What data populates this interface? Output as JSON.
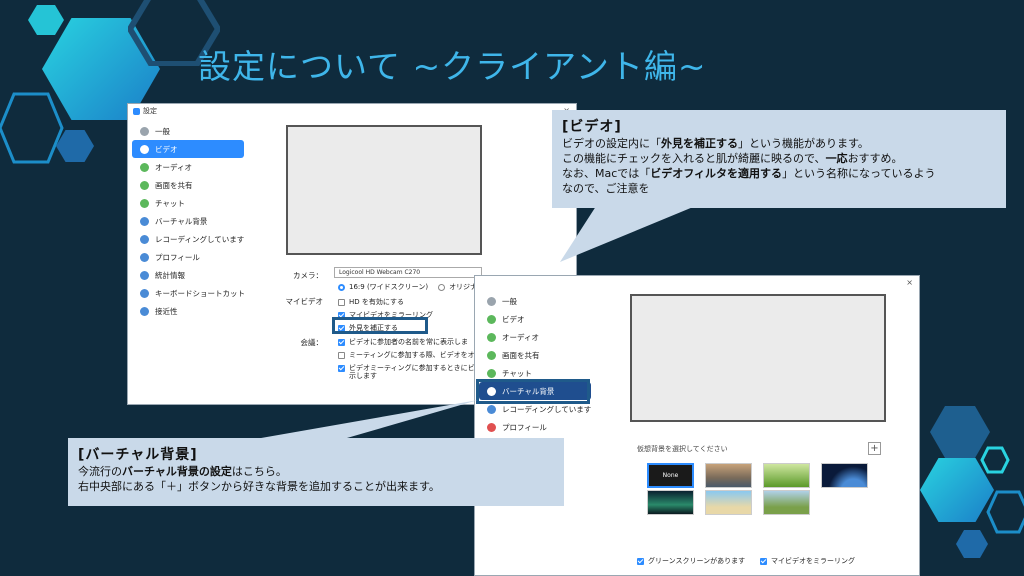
{
  "slide": {
    "title": "設定について ~クライアント編~"
  },
  "window1": {
    "title": "設定",
    "close": "×",
    "sidebar": [
      {
        "label": "一般",
        "icon": "gear-icon"
      },
      {
        "label": "ビデオ",
        "icon": "video-icon",
        "active": true
      },
      {
        "label": "オーディオ",
        "icon": "headphone-icon"
      },
      {
        "label": "画面を共有",
        "icon": "share-screen-icon"
      },
      {
        "label": "チャット",
        "icon": "chat-icon"
      },
      {
        "label": "バーチャル背景",
        "icon": "virtual-background-icon"
      },
      {
        "label": "レコーディングしています",
        "icon": "record-icon"
      },
      {
        "label": "プロフィール",
        "icon": "profile-icon"
      },
      {
        "label": "統計情報",
        "icon": "statistics-icon"
      },
      {
        "label": "キーボードショートカット",
        "icon": "keyboard-icon"
      },
      {
        "label": "接近性",
        "icon": "accessibility-icon"
      }
    ],
    "camera_label": "カメラ：",
    "camera_value": "Logicool HD Webcam C270",
    "ratio_169": "16:9 (ワイドスクリーン)",
    "ratio_orig": "オリジナルサ",
    "myvideo_label": "マイビデオ",
    "hd": "HD を有効にする",
    "mirror": "マイビデオをミラーリング",
    "touchup": "外見を補正する",
    "meeting_label": "会議：",
    "show_names": "ビデオに参加者の名前を常に表示しま",
    "turn_off": "ミーティングに参加する際、ビデオをオフ",
    "preview_dialog": "ビデオミーティングに参加するときにビデ",
    "preview_dialog2": "示します"
  },
  "window2": {
    "close": "×",
    "sidebar": [
      {
        "label": "一般",
        "icon": "gear-icon"
      },
      {
        "label": "ビデオ",
        "icon": "video-icon"
      },
      {
        "label": "オーディオ",
        "icon": "headphone-icon"
      },
      {
        "label": "画面を共有",
        "icon": "share-screen-icon"
      },
      {
        "label": "チャット",
        "icon": "chat-icon"
      },
      {
        "label": "バーチャル背景",
        "icon": "virtual-background-icon",
        "active": true
      },
      {
        "label": "レコーディングしています",
        "icon": "record-icon"
      },
      {
        "label": "プロフィール",
        "icon": "profile-icon"
      }
    ],
    "choose_bg": "仮想背景を選択してください",
    "add_button": "+",
    "none_label": "None",
    "green_screen": "グリーンスクリーンがあります",
    "mirror": "マイビデオをミラーリング"
  },
  "callout_video": {
    "title": "[ビデオ]",
    "line1": "ビデオの設定内に「",
    "line1_bold": "外見を補正する",
    "line1_end": "」という機能があります。",
    "line2": "この機能にチェックを入れると肌が綺麗に映るので、",
    "line2_bold": "一応",
    "line2_end": "おすすめ。",
    "line3": "なお、Macでは「",
    "line3_bold": "ビデオフィルタを適用する",
    "line3_end": "」という名称になっているよう",
    "line4": "なので、ご注意を"
  },
  "callout_virtual": {
    "title": "[バーチャル背景]",
    "line1": "今流行の",
    "line1_bold": "バーチャル背景の設定",
    "line1_end": "はこちら。",
    "line2": "右中央部にある「＋」ボタンから好きな背景を追加することが出来ます。"
  },
  "colors": {
    "background": "#0f2b3d",
    "title": "#3fb6ea",
    "zoom_blue": "#2d8cff",
    "highlight": "#1f5a8a",
    "callout": "#c9d9e9"
  }
}
